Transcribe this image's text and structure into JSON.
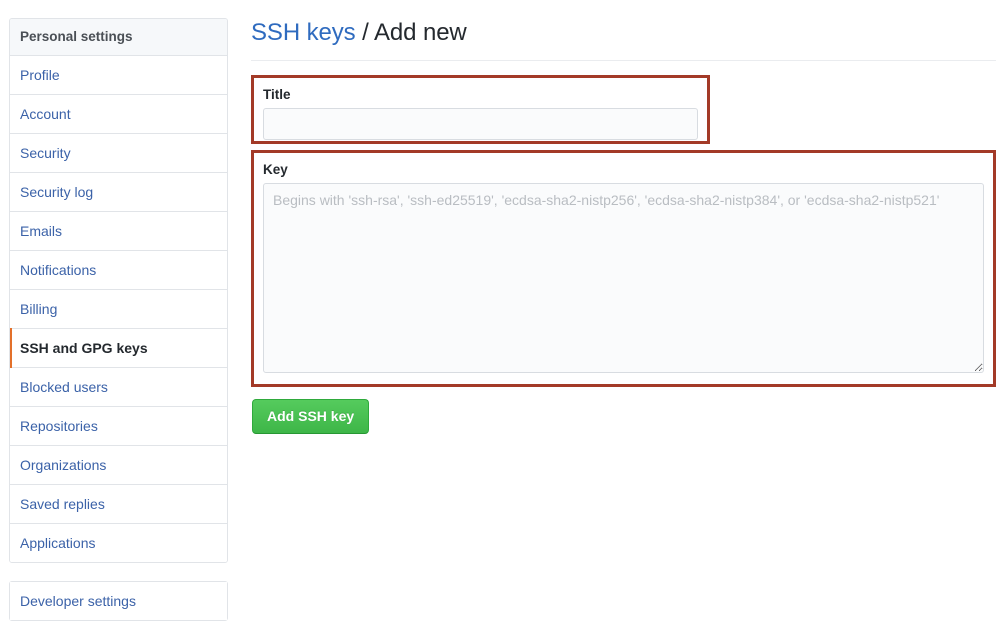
{
  "sidebar": {
    "header": "Personal settings",
    "items": [
      {
        "label": "Profile",
        "selected": false
      },
      {
        "label": "Account",
        "selected": false
      },
      {
        "label": "Security",
        "selected": false
      },
      {
        "label": "Security log",
        "selected": false
      },
      {
        "label": "Emails",
        "selected": false
      },
      {
        "label": "Notifications",
        "selected": false
      },
      {
        "label": "Billing",
        "selected": false
      },
      {
        "label": "SSH and GPG keys",
        "selected": true
      },
      {
        "label": "Blocked users",
        "selected": false
      },
      {
        "label": "Repositories",
        "selected": false
      },
      {
        "label": "Organizations",
        "selected": false
      },
      {
        "label": "Saved replies",
        "selected": false
      },
      {
        "label": "Applications",
        "selected": false
      }
    ],
    "footer_item": "Developer settings"
  },
  "main": {
    "title_link": "SSH keys",
    "title_separator": " / ",
    "title_current": "Add new",
    "title_label": "Title",
    "title_value": "",
    "title_placeholder": "",
    "key_label": "Key",
    "key_value": "",
    "key_placeholder": "Begins with 'ssh-rsa', 'ssh-ed25519', 'ecdsa-sha2-nistp256', 'ecdsa-sha2-nistp384', or 'ecdsa-sha2-nistp521'",
    "submit_label": "Add SSH key"
  },
  "colors": {
    "link_blue": "#3b62a8",
    "title_link_blue": "#2f6bbf",
    "highlight_red": "#a33a27",
    "selected_orange": "#e3702a",
    "button_green": "#44c051",
    "header_gray": "#f6f8fa",
    "border_gray": "#e1e4e8"
  }
}
